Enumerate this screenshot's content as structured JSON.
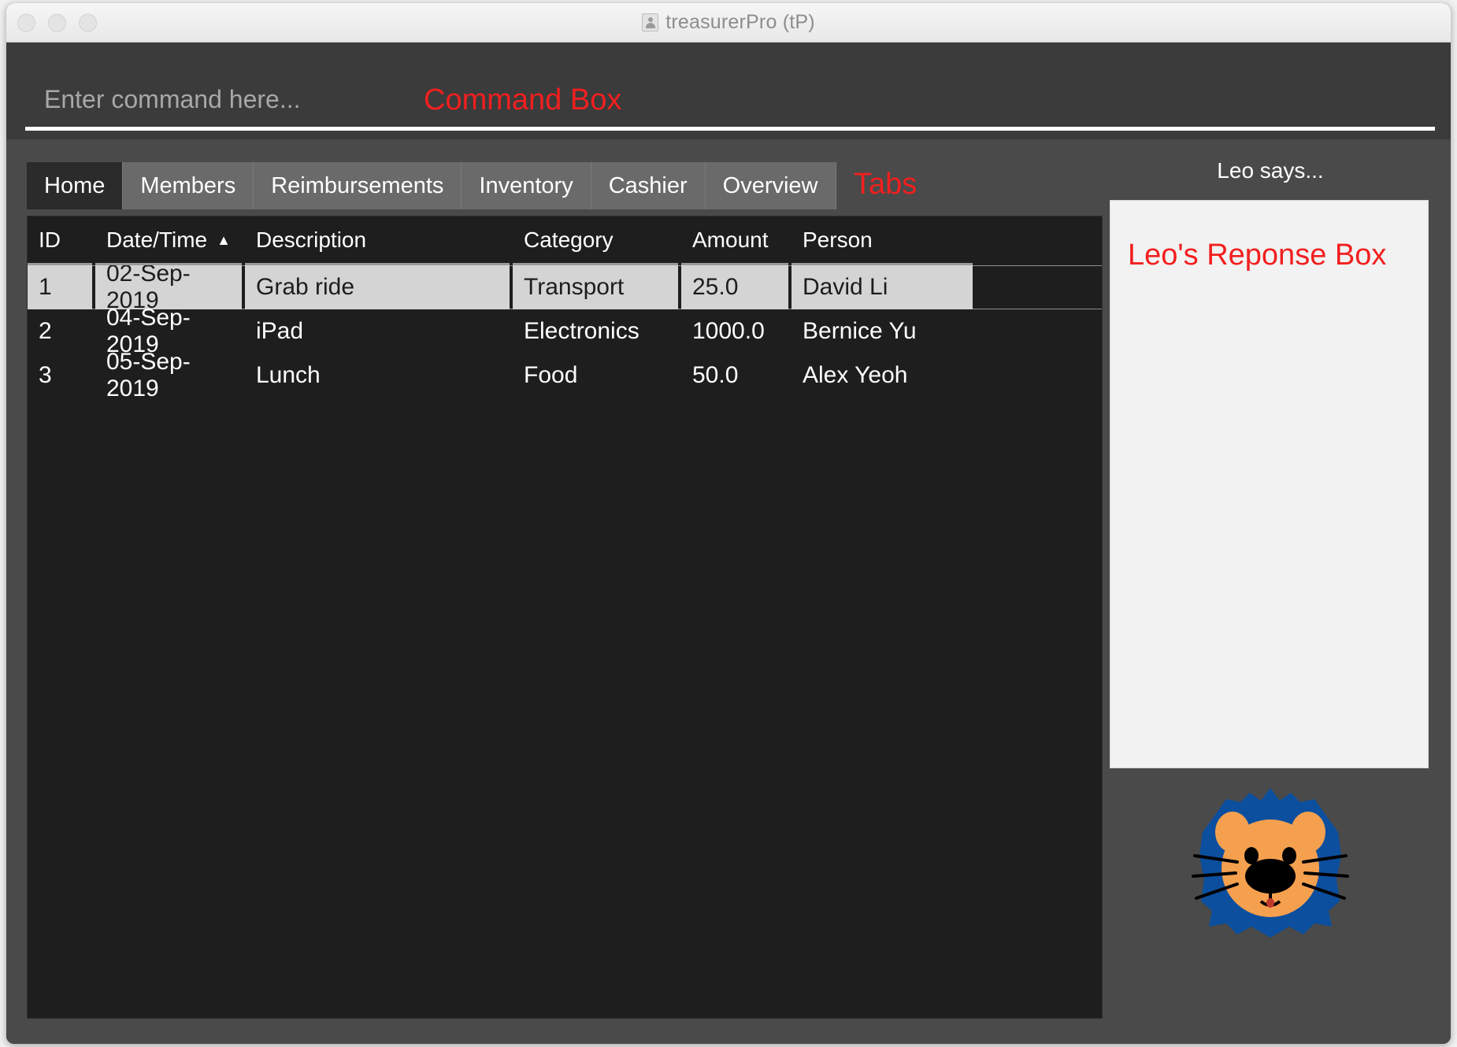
{
  "window": {
    "title": "treasurerPro (tP)",
    "title_icon": "person-badge-icon",
    "traffic_lights": [
      "close",
      "minimize",
      "maximize"
    ]
  },
  "command_box": {
    "placeholder": "Enter command here...",
    "value": "",
    "annotation": "Command Box"
  },
  "tabs": {
    "annotation": "Tabs",
    "active": "Home",
    "items": [
      {
        "label": "Home"
      },
      {
        "label": "Members"
      },
      {
        "label": "Reimbursements"
      },
      {
        "label": "Inventory"
      },
      {
        "label": "Cashier"
      },
      {
        "label": "Overview"
      }
    ]
  },
  "table": {
    "sort_column": "Date/Time",
    "sort_direction": "ascending",
    "sort_arrow_glyph": "▲",
    "columns": [
      "ID",
      "Date/Time",
      "Description",
      "Category",
      "Amount",
      "Person"
    ],
    "rows": [
      {
        "id": "1",
        "date": "02-Sep-2019",
        "description": "Grab ride",
        "category": "Transport",
        "amount": "25.0",
        "person": "David Li",
        "selected": true
      },
      {
        "id": "2",
        "date": "04-Sep-2019",
        "description": "iPad",
        "category": "Electronics",
        "amount": "1000.0",
        "person": "Bernice Yu",
        "selected": false
      },
      {
        "id": "3",
        "date": "05-Sep-2019",
        "description": "Lunch",
        "category": "Food",
        "amount": "50.0",
        "person": "Alex Yeoh",
        "selected": false
      }
    ]
  },
  "right_panel": {
    "heading": "Leo says...",
    "response_box_text": "Leo's Reponse Box",
    "response_box_value": "",
    "mascot": "lion-mascot-icon"
  },
  "colors": {
    "annotation_red": "#f21f1f",
    "window_chrome": "#4a4a4a",
    "panel_dark": "#3b3b3b",
    "table_background": "#1e1e1e",
    "tab_inactive": "#6a6a6a",
    "tab_active": "#2b2b2b",
    "selected_row": "#d4d4d4",
    "response_box": "#f2f2f2",
    "mane_blue": "#0b4f9e",
    "face_orange": "#f5a košice"
  }
}
